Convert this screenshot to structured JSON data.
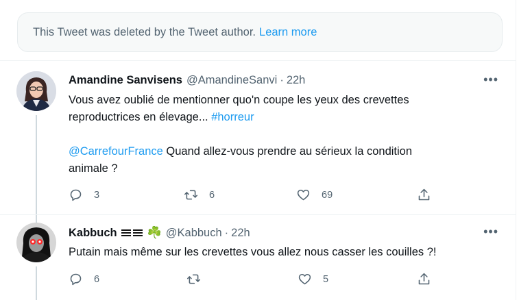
{
  "deleted_notice": {
    "text": "This Tweet was deleted by the Tweet author.",
    "link": "Learn more"
  },
  "tweets": [
    {
      "name": "Amandine Sanvisens",
      "handle": "@AmandineSanvi",
      "dot": "·",
      "time": "22h",
      "more": "•••",
      "line1_text": "Vous avez oublié de mentionner quo'n coupe les yeux des crevettes",
      "line2_text": "reproductrices en élevage... ",
      "hashtag": "#horreur",
      "mention": "@CarrefourFrance",
      "line3_text": " Quand allez-vous prendre au sérieux la condition",
      "line4_text": "animale ?",
      "replies": "3",
      "retweets": "6",
      "likes": "69"
    },
    {
      "name": "Kabbuch",
      "handle": "@Kabbuch",
      "dot": "·",
      "time": "22h",
      "more": "•••",
      "clover": "☘️",
      "text": "Putain mais même sur les crevettes vous allez nous casser les couilles ?!",
      "replies": "6",
      "retweets": "",
      "likes": "5"
    }
  ],
  "colors": {
    "accent": "#1d9bf0",
    "secondary_text": "#536471",
    "primary_text": "#0f1419"
  }
}
